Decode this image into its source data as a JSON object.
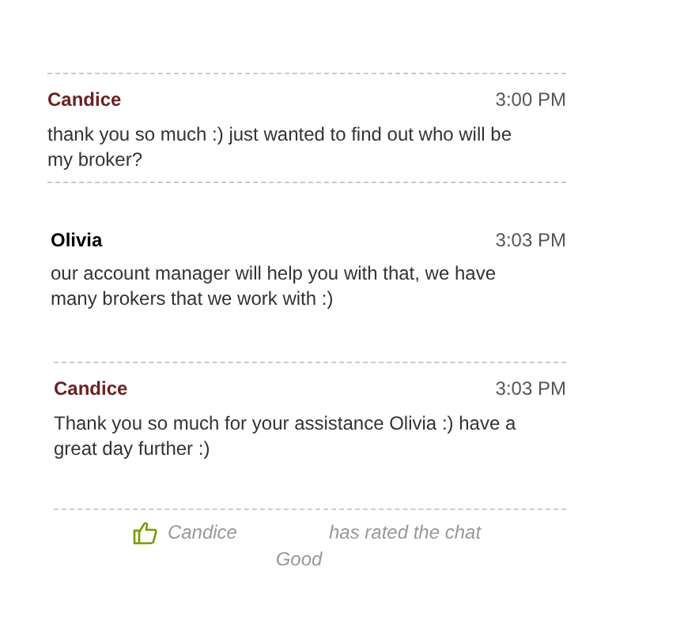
{
  "messages": [
    {
      "kind": "visitor",
      "name": "Candice",
      "time": "3:00 PM",
      "text": "thank you so much :) just wanted to find out who will be my broker?"
    },
    {
      "kind": "agent",
      "name": "Olivia",
      "time": "3:03 PM",
      "text": "our account manager will help you with that, we have many brokers that we work with :)"
    },
    {
      "kind": "visitor",
      "name": "Candice",
      "time": "3:03 PM",
      "text": "Thank you so much for your assistance Olivia :) have a great day further :)"
    }
  ],
  "rating": {
    "name": "Candice",
    "text": "has rated the chat",
    "value": "Good"
  }
}
